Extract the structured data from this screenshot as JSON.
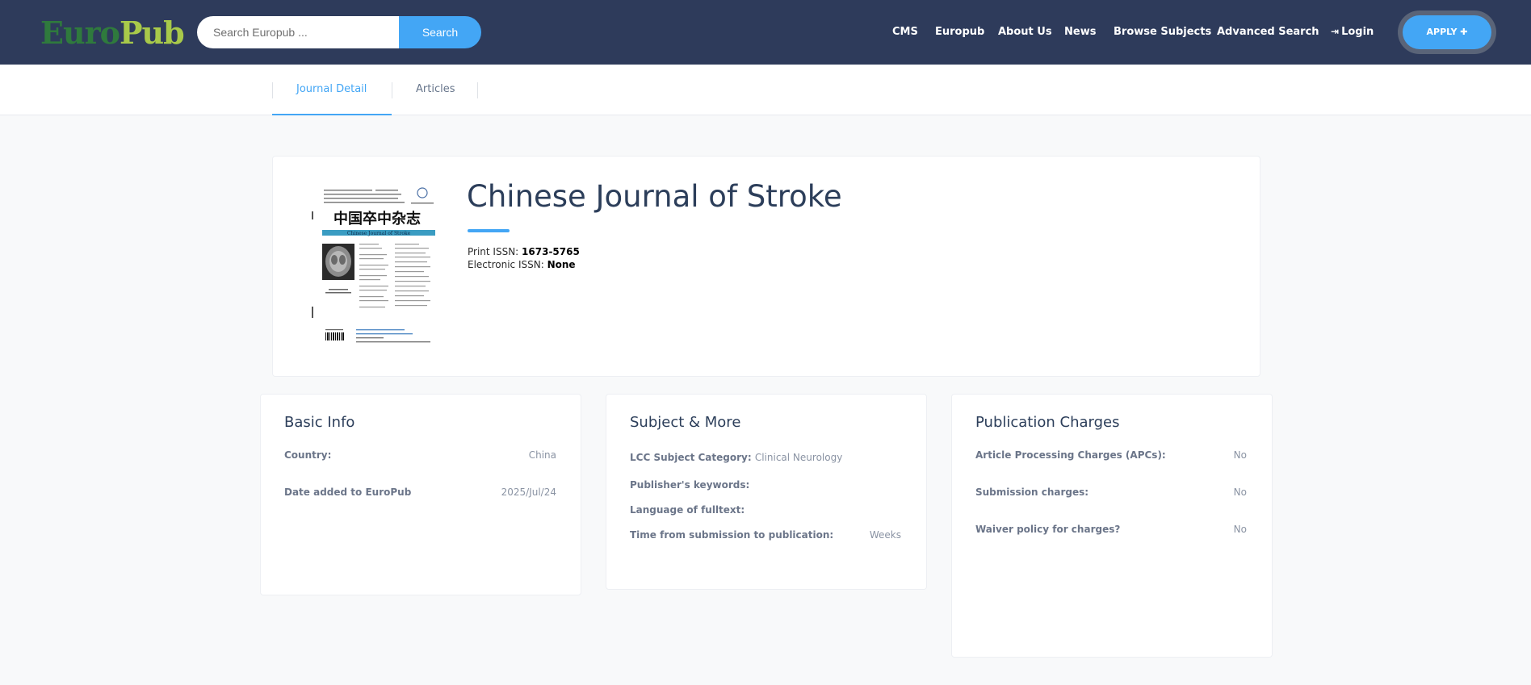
{
  "brand": {
    "logo_part1": "Euro",
    "logo_part2": "Pub"
  },
  "search": {
    "placeholder": "Search Europub ...",
    "button_label": "Search"
  },
  "nav": {
    "items": [
      "CMS",
      "Europub",
      "About Us",
      "News",
      "Browse Subjects",
      "Advanced Search"
    ],
    "login_label": "Login",
    "apply_label": "APPLY",
    "apply_icon": "plus-icon",
    "login_icon": "sign-in-icon"
  },
  "tabs": [
    {
      "label": "Journal Detail",
      "active": true
    },
    {
      "label": "Articles",
      "active": false
    }
  ],
  "journal": {
    "title": "Chinese Journal of Stroke",
    "print_issn_label": "Print ISSN:",
    "print_issn": "1673-5765",
    "electronic_issn_label": "Electronic ISSN:",
    "electronic_issn": "None",
    "cover": {
      "title_cn": "中国卒中杂志",
      "title_en": "Chinese Journal of Stroke"
    }
  },
  "basic_info": {
    "title": "Basic Info",
    "rows": [
      {
        "label": "Country:",
        "value": "China"
      },
      {
        "label": "Date added to EuroPub",
        "value": "2025/Jul/24"
      }
    ]
  },
  "subject": {
    "title": "Subject & More",
    "lcc_label": "LCC Subject Category:",
    "lcc_value": "Clinical Neurology",
    "keywords_label": "Publisher's keywords:",
    "language_label": "Language of fulltext:",
    "time_label": "Time from submission to publication:",
    "time_value": "Weeks"
  },
  "charges": {
    "title": "Publication Charges",
    "rows": [
      {
        "label": "Article Processing Charges (APCs):",
        "value": "No"
      },
      {
        "label": "Submission charges:",
        "value": "No"
      },
      {
        "label": "Waiver policy for charges?",
        "value": "No"
      }
    ]
  },
  "colors": {
    "navbar": "#2e3b5b",
    "accent": "#43a6f5",
    "logo_green": "#2f7a3d",
    "logo_lime": "#a8c94a"
  }
}
